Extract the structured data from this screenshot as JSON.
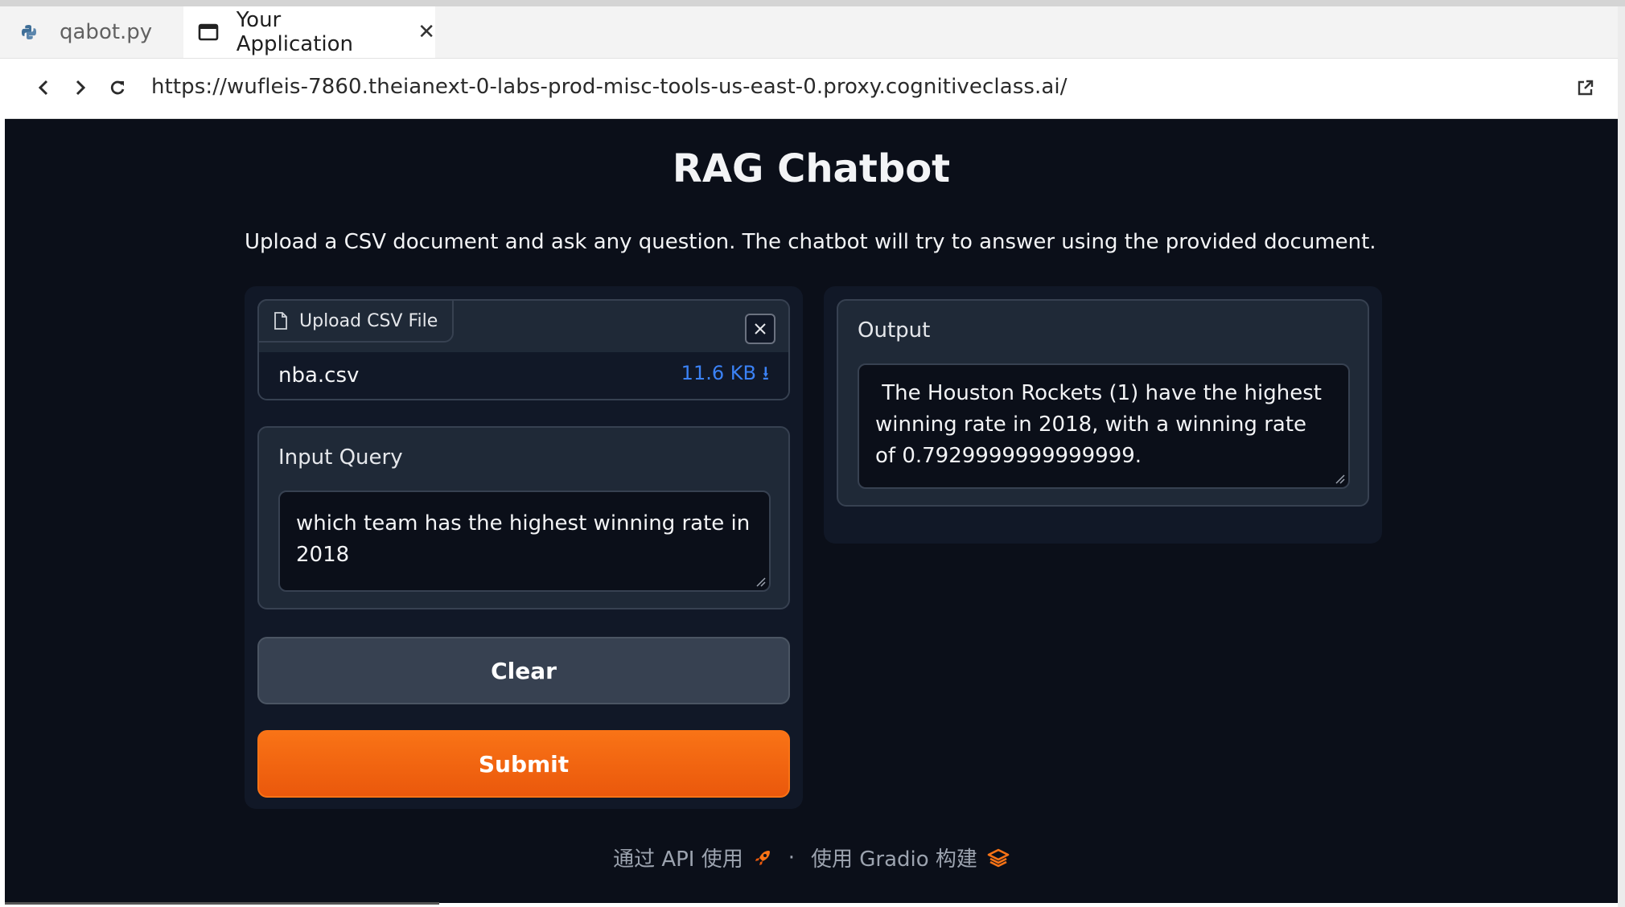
{
  "browser": {
    "tabs": [
      {
        "label": "qabot.py",
        "icon": "python-icon",
        "active": false
      },
      {
        "label": "Your Application",
        "icon": "window-icon",
        "active": true
      }
    ],
    "url": "https://wufleis-7860.theianext-0-labs-prod-misc-tools-us-east-0.proxy.cognitiveclass.ai/"
  },
  "app": {
    "title": "RAG Chatbot",
    "description": "Upload a CSV document and ask any question. The chatbot will try to answer using the provided document.",
    "upload": {
      "label": "Upload CSV File",
      "file_name": "nba.csv",
      "file_size": "11.6 KB",
      "download_glyph": "⭳"
    },
    "query": {
      "label": "Input Query",
      "value": "which team has the highest winning rate in 2018"
    },
    "buttons": {
      "clear": "Clear",
      "submit": "Submit"
    },
    "output": {
      "label": "Output",
      "value": " The Houston Rockets (1) have the highest winning rate in 2018, with a winning rate of 0.7929999999999999."
    },
    "footer": {
      "api_link": "通过 API 使用",
      "separator": "·",
      "built_with": "使用 Gradio 构建"
    }
  },
  "colors": {
    "app_bg": "#0b0f19",
    "panel_bg": "#111827",
    "block_bg": "#1f2937",
    "accent_orange": "#f97316",
    "link_blue": "#3b82f6"
  }
}
